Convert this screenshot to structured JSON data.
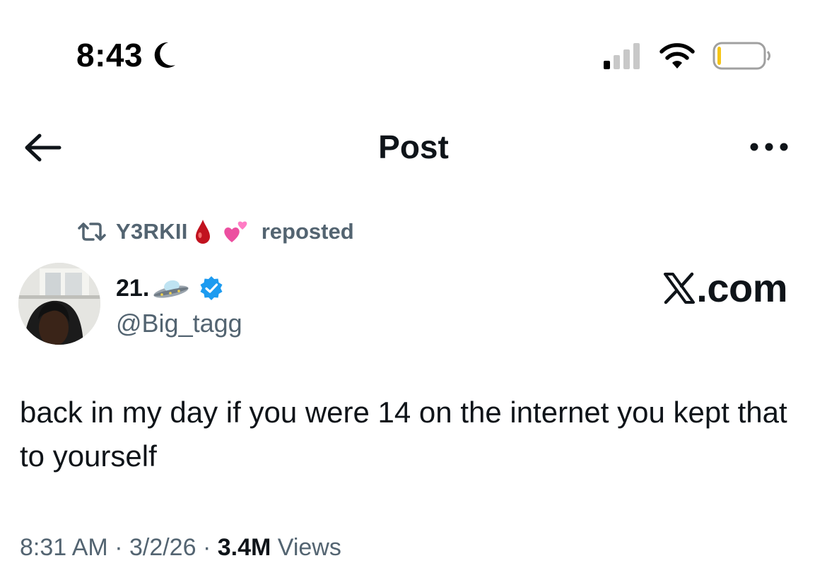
{
  "status_bar": {
    "time": "8:43",
    "focus_icon": "moon-icon",
    "signal_icon": "signal-icon",
    "wifi_icon": "wifi-icon",
    "battery_icon": "battery-icon",
    "battery_level": 0.06,
    "battery_color": "#f5c518"
  },
  "header": {
    "back_icon": "back-arrow-icon",
    "title": "Post",
    "more_icon": "more-icon"
  },
  "repost": {
    "icon": "repost-icon",
    "user": "Y3RKII",
    "emoji_1": "🩸",
    "emoji_2": "💞",
    "suffix": "reposted"
  },
  "author": {
    "display_name": "21.",
    "name_emoji": "🛸",
    "verified": true,
    "verified_color": "#1d9bf0",
    "handle": "@Big_tagg"
  },
  "brand": {
    "text": ".com",
    "logo": "x-logo-icon"
  },
  "post": {
    "text": "back in my day if you were 14 on the internet you kept that to yourself"
  },
  "meta": {
    "time": "8:31 AM",
    "separator": " · ",
    "date": "3/2/26",
    "views_count": "3.4M",
    "views_label": " Views"
  }
}
